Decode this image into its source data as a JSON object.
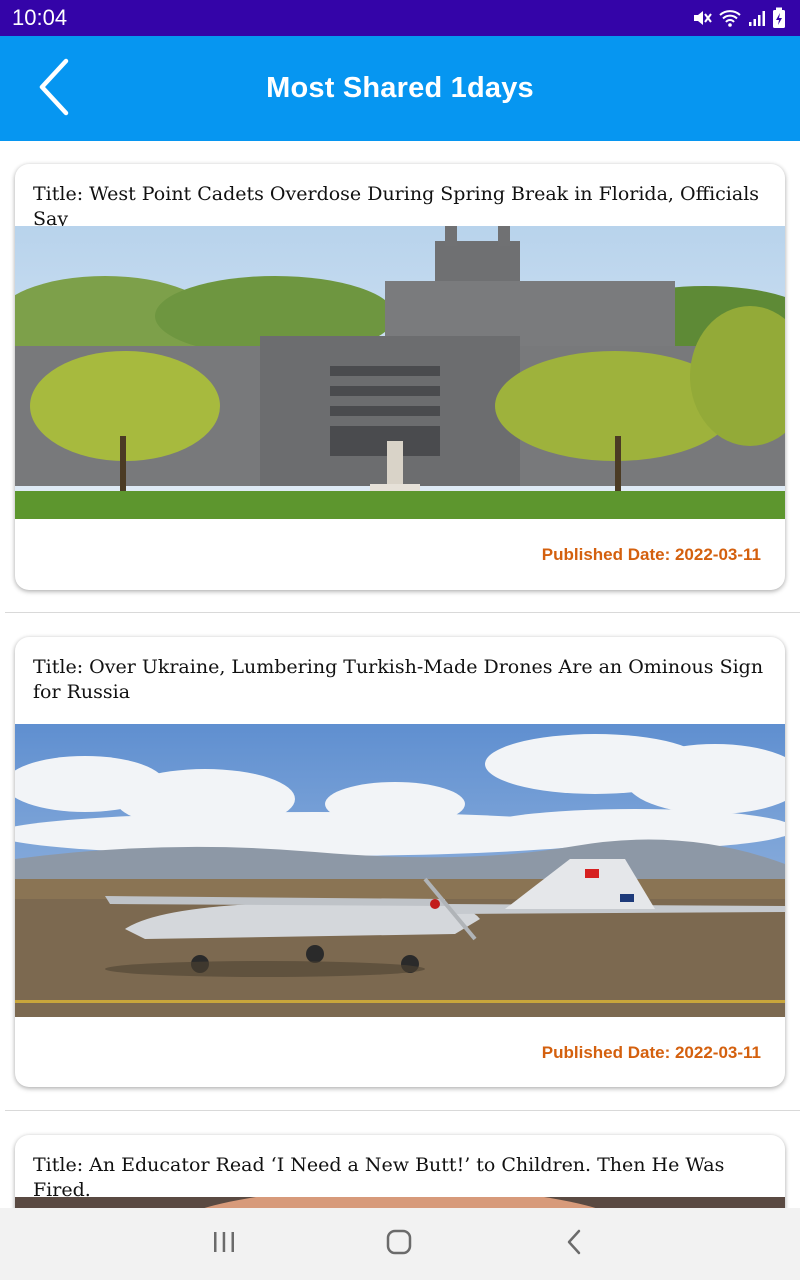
{
  "status_bar": {
    "time": "10:04"
  },
  "app_bar": {
    "title": "Most Shared 1days"
  },
  "articles": [
    {
      "title": "Title: West Point Cadets Overdose During Spring Break in Florida, Officials Say",
      "published": "Published Date: 2022-03-11"
    },
    {
      "title": "Title: Over Ukraine, Lumbering Turkish-Made Drones Are an Ominous Sign for Russia",
      "published": "Published Date: 2022-03-11"
    },
    {
      "title": "Title: An Educator Read ‘I Need a New Butt!’ to Children. Then He Was Fired."
    }
  ],
  "colors": {
    "status_bar": "#3404a8",
    "app_bar": "#0696f1",
    "date_text": "#d4600e",
    "nav_bar": "#f2f2f2"
  },
  "icons": {
    "back": "chevron-left-icon",
    "mute": "mute-icon",
    "wifi": "wifi-icon",
    "signal": "signal-icon",
    "battery": "battery-charging-icon",
    "nav_recents": "recents-icon",
    "nav_home": "home-icon",
    "nav_back": "back-icon"
  }
}
